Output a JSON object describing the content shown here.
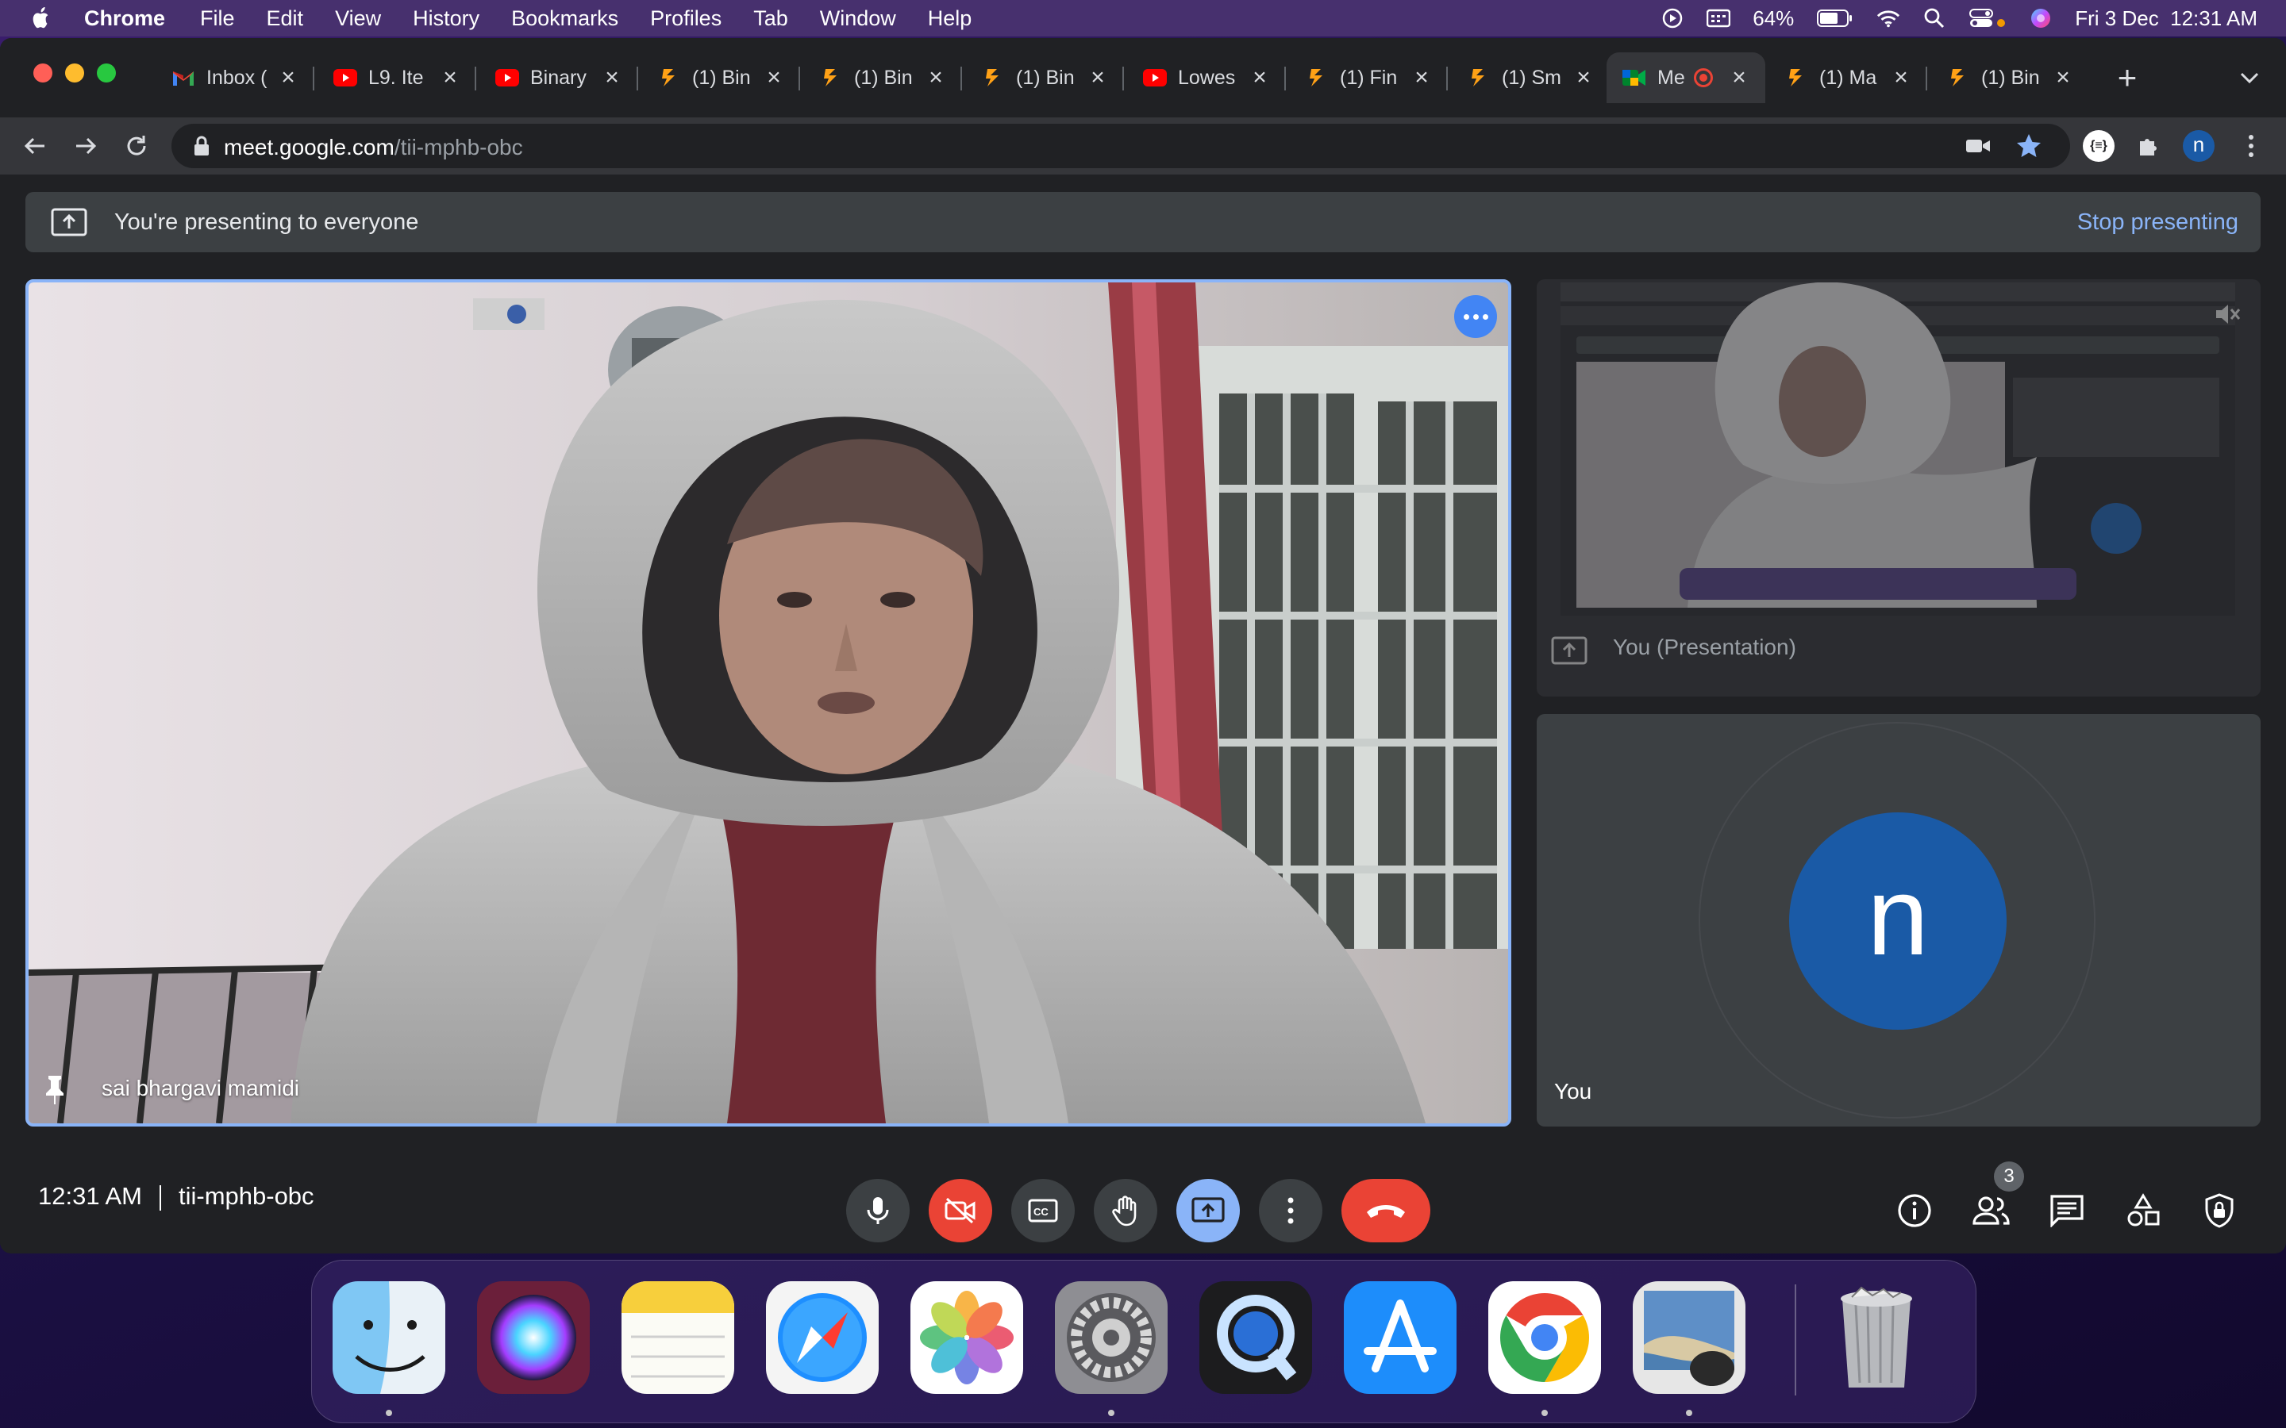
{
  "menubar": {
    "app_name": "Chrome",
    "menus": [
      "File",
      "Edit",
      "View",
      "History",
      "Bookmarks",
      "Profiles",
      "Tab",
      "Window",
      "Help"
    ],
    "battery": "64%",
    "datetime": "Fri 3 Dec  12:31 AM"
  },
  "tabs": [
    {
      "title": "Inbox (",
      "icon": "gmail-icon"
    },
    {
      "title": "L9. Ite",
      "icon": "youtube-icon"
    },
    {
      "title": "Binary",
      "icon": "youtube-icon"
    },
    {
      "title": "(1) Bin",
      "icon": "site-icon"
    },
    {
      "title": "(1) Bin",
      "icon": "site-icon"
    },
    {
      "title": "(1) Bin",
      "icon": "site-icon"
    },
    {
      "title": "Lowes",
      "icon": "youtube-icon"
    },
    {
      "title": "(1) Fin",
      "icon": "site-icon"
    },
    {
      "title": "(1) Sm",
      "icon": "site-icon"
    },
    {
      "title": "Me",
      "icon": "meet-icon",
      "active": true
    },
    {
      "title": "(1) Ma",
      "icon": "site-icon"
    },
    {
      "title": "(1) Bin",
      "icon": "site-icon"
    }
  ],
  "address": {
    "host": "meet.google.com",
    "path": "/tii-mphb-obc"
  },
  "presenting": {
    "message": "You're presenting to everyone",
    "stop_label": "Stop presenting"
  },
  "tiles": {
    "main_name": "sai bhargavi mamidi",
    "presentation_label": "You (Presentation)",
    "you_label": "You",
    "avatar_letter": "n"
  },
  "meeting": {
    "time": "12:31 AM",
    "code": "tii-mphb-obc",
    "participants_count": "3"
  },
  "dock": [
    "Finder",
    "Siri",
    "Notes",
    "Safari",
    "Photos",
    "System Preferences",
    "QuickTime Player",
    "App Store",
    "Google Chrome",
    "Preview",
    "Trash"
  ],
  "colors": {
    "accent": "#8ab4f8",
    "danger": "#ea4335",
    "avatar": "#1a5aa6",
    "surface": "#202124"
  }
}
